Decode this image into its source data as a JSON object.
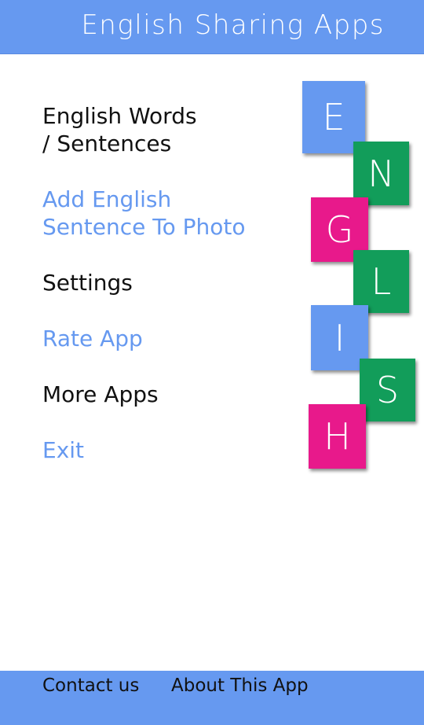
{
  "header": {
    "title": "English Sharing Apps"
  },
  "menu": {
    "items": [
      {
        "line1": "English Words",
        "line2": "/ Sentences",
        "color": "#111111"
      },
      {
        "line1": "Add English",
        "line2": "Sentence To Photo",
        "color": "#6699f0"
      },
      {
        "line1": "Settings",
        "color": "#111111"
      },
      {
        "line1": "Rate App",
        "color": "#6699f0"
      },
      {
        "line1": "More Apps",
        "color": "#111111"
      },
      {
        "line1": "Exit",
        "color": "#6699f0"
      }
    ]
  },
  "logo": {
    "letters": [
      "E",
      "N",
      "G",
      "L",
      "I",
      "S",
      "H"
    ],
    "colors": {
      "blue": "#6699f0",
      "green": "#129d5a",
      "pink": "#e8198b"
    }
  },
  "footer": {
    "contact_label": "Contact us",
    "about_label": "About This App"
  },
  "theme": {
    "primary": "#6699f0"
  }
}
